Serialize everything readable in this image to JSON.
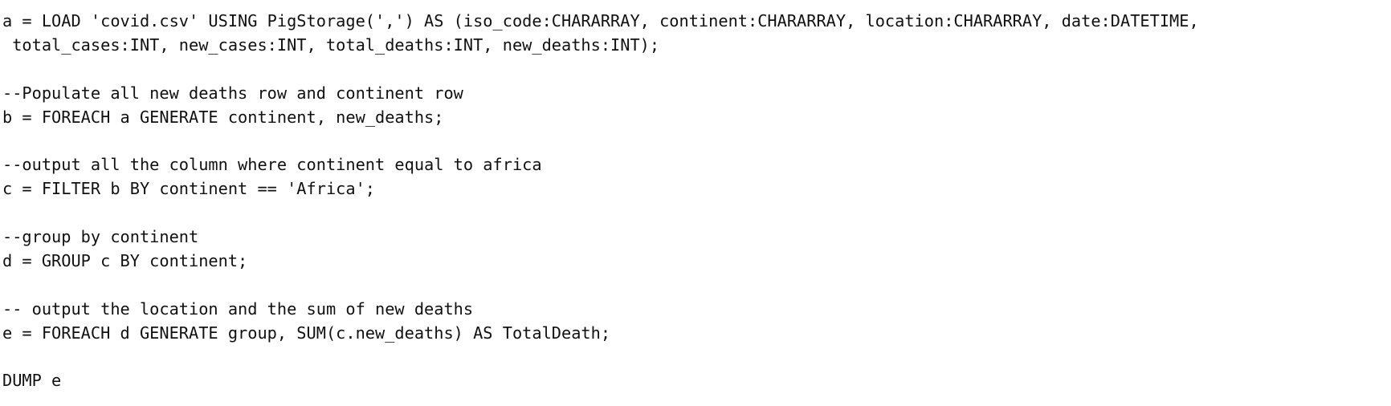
{
  "editor": {
    "lines": [
      {
        "kind": "code",
        "text": "a = LOAD 'covid.csv' USING PigStorage(',') AS (iso_code:CHARARRAY, continent:CHARARRAY, location:CHARARRAY, date:DATETIME,"
      },
      {
        "kind": "code",
        "text": " total_cases:INT, new_cases:INT, total_deaths:INT, new_deaths:INT);"
      },
      {
        "kind": "blank",
        "text": ""
      },
      {
        "kind": "comment",
        "text": "--Populate all new deaths row and continent row"
      },
      {
        "kind": "code",
        "text": "b = FOREACH a GENERATE continent, new_deaths;"
      },
      {
        "kind": "blank",
        "text": ""
      },
      {
        "kind": "comment",
        "text": "--output all the column where continent equal to africa"
      },
      {
        "kind": "code",
        "text": "c = FILTER b BY continent == 'Africa';"
      },
      {
        "kind": "blank",
        "text": ""
      },
      {
        "kind": "comment",
        "text": "--group by continent"
      },
      {
        "kind": "code",
        "text": "d = GROUP c BY continent;"
      },
      {
        "kind": "blank",
        "text": ""
      },
      {
        "kind": "comment",
        "text": "-- output the location and the sum of new deaths"
      },
      {
        "kind": "code",
        "text": "e = FOREACH d GENERATE group, SUM(c.new_deaths) AS TotalDeath;"
      },
      {
        "kind": "blank",
        "text": ""
      },
      {
        "kind": "code",
        "text": "DUMP e"
      }
    ]
  }
}
